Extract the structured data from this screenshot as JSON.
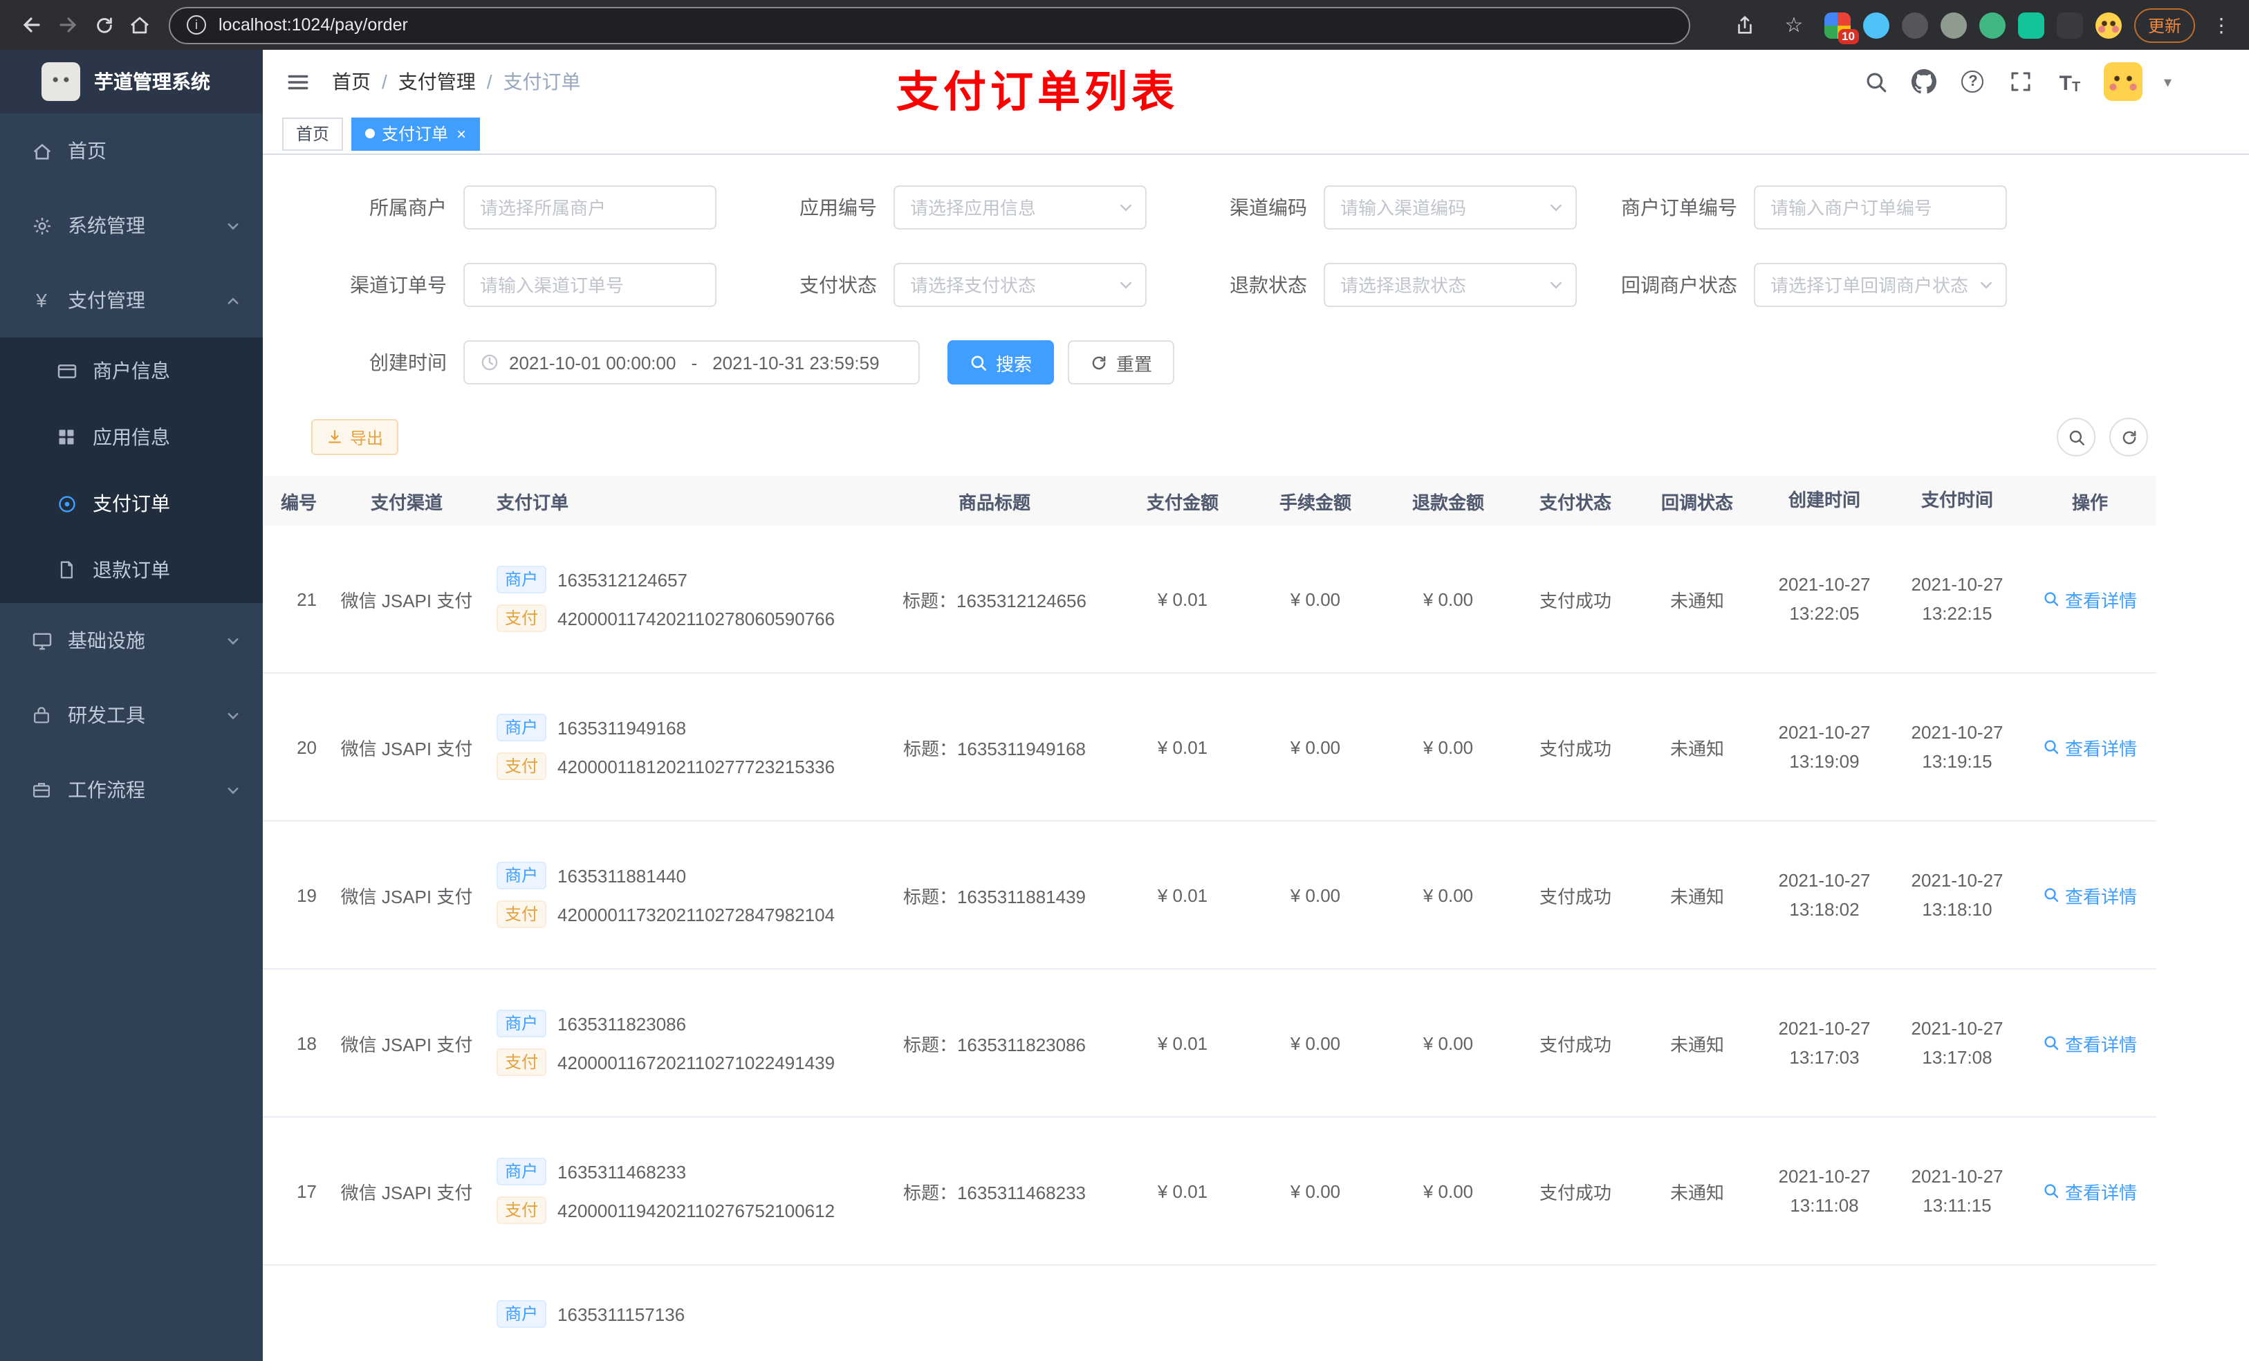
{
  "theme": {
    "primary": "#409eff",
    "warning": "#e6a23c",
    "annotation_red": "#fb0000",
    "sidebar_bg": "#304156"
  },
  "icons": {
    "info": "i",
    "question": "?",
    "yen": "¥",
    "kebab": "⋮",
    "caret": "▾",
    "close": "×",
    "slash": "/",
    "star": "☆",
    "font_large": "T",
    "font_small": "T"
  },
  "browser": {
    "url": "localhost:1024/pay/order",
    "update_label": "更新",
    "extension_badge": "10"
  },
  "sidebar": {
    "logo_title": "芋道管理系统",
    "menu": [
      {
        "label": "首页"
      },
      {
        "label": "系统管理"
      },
      {
        "label": "支付管理"
      },
      {
        "label": "基础设施"
      },
      {
        "label": "研发工具"
      },
      {
        "label": "工作流程"
      }
    ],
    "submenu": [
      {
        "label": "商户信息"
      },
      {
        "label": "应用信息"
      },
      {
        "label": "支付订单"
      },
      {
        "label": "退款订单"
      }
    ]
  },
  "header": {
    "breadcrumb": [
      "首页",
      "支付管理",
      "支付订单"
    ],
    "annotation": "支付订单列表"
  },
  "tabs": {
    "items": [
      {
        "label": "首页"
      },
      {
        "label": "支付订单"
      }
    ]
  },
  "filters": {
    "row1": [
      {
        "label": "所属商户",
        "placeholder": "请选择所属商户"
      },
      {
        "label": "应用编号",
        "placeholder": "请选择应用信息"
      },
      {
        "label": "渠道编码",
        "placeholder": "请输入渠道编码"
      },
      {
        "label": "商户订单编号",
        "placeholder": "请输入商户订单编号"
      }
    ],
    "row2": [
      {
        "label": "渠道订单号",
        "placeholder": "请输入渠道订单号"
      },
      {
        "label": "支付状态",
        "placeholder": "请选择支付状态"
      },
      {
        "label": "退款状态",
        "placeholder": "请选择退款状态"
      },
      {
        "label": "回调商户状态",
        "placeholder": "请选择订单回调商户状态"
      }
    ],
    "date_label": "创建时间",
    "date_start": "2021-10-01 00:00:00",
    "date_separator": "-",
    "date_end": "2021-10-31 23:59:59",
    "search_label": "搜索",
    "reset_label": "重置"
  },
  "toolbar": {
    "export_label": "导出"
  },
  "table": {
    "headers": [
      "编号",
      "支付渠道",
      "支付订单",
      "商品标题",
      "支付金额",
      "手续金额",
      "退款金额",
      "支付状态",
      "回调状态",
      "创建时间",
      "支付时间",
      "操作"
    ],
    "merchant_tag": "商户",
    "pay_tag": "支付",
    "action_label": "查看详情",
    "rows": [
      {
        "id": "21",
        "channel": "微信 JSAPI 支付",
        "merchant_no": "1635312124657",
        "pay_no": "4200001174202110278060590766",
        "title": "标题：1635312124656",
        "pay_amount": "¥ 0.01",
        "fee_amount": "¥ 0.00",
        "refund_amount": "¥ 0.00",
        "pay_status": "支付成功",
        "notify_status": "未通知",
        "create_date": "2021-10-27",
        "create_time": "13:22:05",
        "pay_date": "2021-10-27",
        "pay_time": "13:22:15"
      },
      {
        "id": "20",
        "channel": "微信 JSAPI 支付",
        "merchant_no": "1635311949168",
        "pay_no": "4200001181202110277723215336",
        "title": "标题：1635311949168",
        "pay_amount": "¥ 0.01",
        "fee_amount": "¥ 0.00",
        "refund_amount": "¥ 0.00",
        "pay_status": "支付成功",
        "notify_status": "未通知",
        "create_date": "2021-10-27",
        "create_time": "13:19:09",
        "pay_date": "2021-10-27",
        "pay_time": "13:19:15"
      },
      {
        "id": "19",
        "channel": "微信 JSAPI 支付",
        "merchant_no": "1635311881440",
        "pay_no": "4200001173202110272847982104",
        "title": "标题：1635311881439",
        "pay_amount": "¥ 0.01",
        "fee_amount": "¥ 0.00",
        "refund_amount": "¥ 0.00",
        "pay_status": "支付成功",
        "notify_status": "未通知",
        "create_date": "2021-10-27",
        "create_time": "13:18:02",
        "pay_date": "2021-10-27",
        "pay_time": "13:18:10"
      },
      {
        "id": "18",
        "channel": "微信 JSAPI 支付",
        "merchant_no": "1635311823086",
        "pay_no": "4200001167202110271022491439",
        "title": "标题：1635311823086",
        "pay_amount": "¥ 0.01",
        "fee_amount": "¥ 0.00",
        "refund_amount": "¥ 0.00",
        "pay_status": "支付成功",
        "notify_status": "未通知",
        "create_date": "2021-10-27",
        "create_time": "13:17:03",
        "pay_date": "2021-10-27",
        "pay_time": "13:17:08"
      },
      {
        "id": "17",
        "channel": "微信 JSAPI 支付",
        "merchant_no": "1635311468233",
        "pay_no": "4200001194202110276752100612",
        "title": "标题：1635311468233",
        "pay_amount": "¥ 0.01",
        "fee_amount": "¥ 0.00",
        "refund_amount": "¥ 0.00",
        "pay_status": "支付成功",
        "notify_status": "未通知",
        "create_date": "2021-10-27",
        "create_time": "13:11:08",
        "pay_date": "2021-10-27",
        "pay_time": "13:11:15"
      }
    ],
    "partial_row": {
      "merchant_no": "1635311157136"
    }
  }
}
